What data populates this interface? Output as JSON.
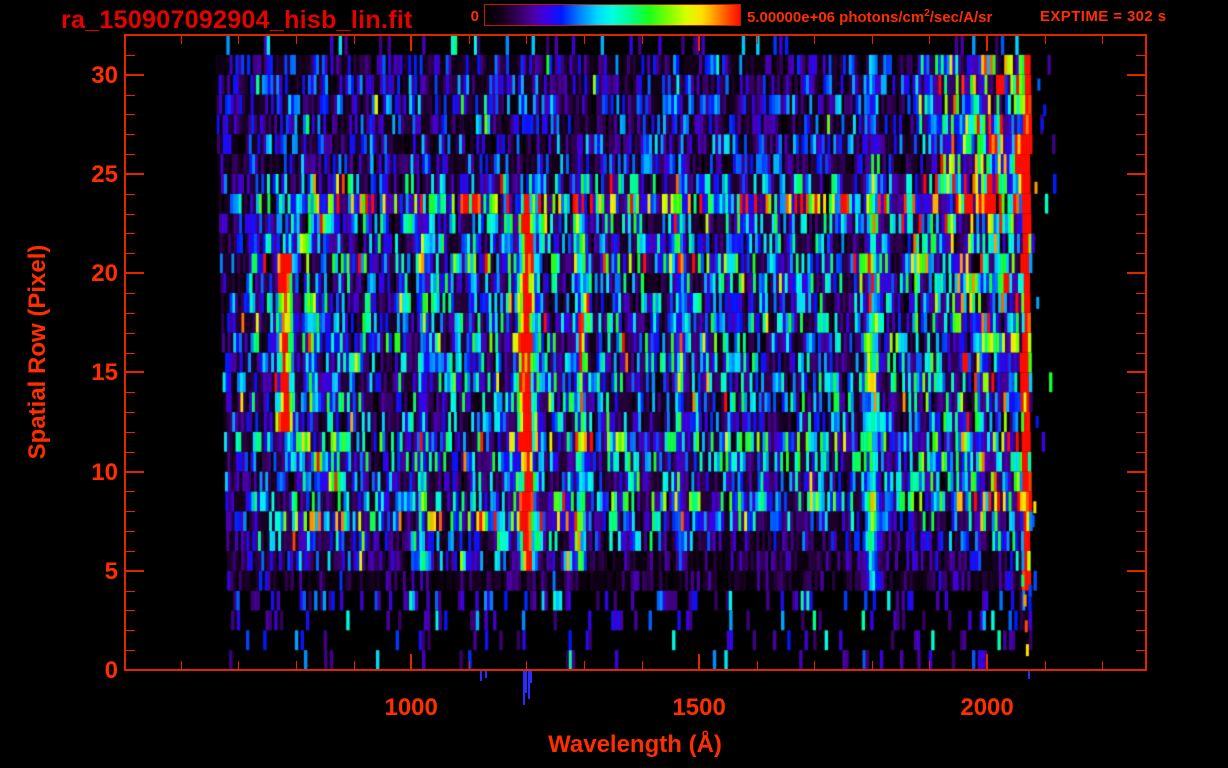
{
  "window": {
    "background": "#000000"
  },
  "colors": {
    "accent": "#e02600",
    "label": "#ff2e00",
    "title": "#e60000",
    "stray_mark": "#2a2cff"
  },
  "header": {
    "title": "ra_150907092904_hisb_lin.fit",
    "colorbar_min_label": "0",
    "colorbar_max_prefix": "5.00000e+06 photons/cm",
    "colorbar_max_sup": "2",
    "colorbar_max_suffix": "/sec/A/sr",
    "exptime_label": "EXPTIME = 302 s"
  },
  "axes": {
    "x_label": "Wavelength (Å)",
    "y_label": "Spatial Row (Pixel)",
    "x_tick_labels": [
      "1000",
      "1500",
      "2000"
    ],
    "y_tick_labels": [
      "0",
      "5",
      "10",
      "15",
      "20",
      "25",
      "30"
    ]
  },
  "chart_data": {
    "type": "heatmap",
    "title": "ra_150907092904_hisb_lin.fit",
    "xlabel": "Wavelength (Å)",
    "ylabel": "Spatial Row (Pixel)",
    "xlim": [
      503,
      2276
    ],
    "ylim": [
      0,
      32
    ],
    "x_ticks_major": [
      1000,
      1500,
      2000
    ],
    "x_minor_range": [
      600,
      2200
    ],
    "x_tick_minor_step": 100,
    "y_ticks_major": [
      0,
      5,
      10,
      15,
      20,
      25,
      30
    ],
    "y_tick_minor_step": 1,
    "exptime_seconds": 302,
    "colorbar": {
      "min": 0,
      "max": 5000000,
      "min_label": "0",
      "max_label": "5.00000e+06 photons/cm2/sec/A/sr",
      "stops": [
        [
          0.0,
          "#000000"
        ],
        [
          0.07,
          "#16001e"
        ],
        [
          0.13,
          "#33005a"
        ],
        [
          0.19,
          "#4b00a8"
        ],
        [
          0.24,
          "#3c00e8"
        ],
        [
          0.3,
          "#0018ff"
        ],
        [
          0.37,
          "#0080ff"
        ],
        [
          0.44,
          "#00d8ff"
        ],
        [
          0.5,
          "#00ffe0"
        ],
        [
          0.57,
          "#00ff8c"
        ],
        [
          0.64,
          "#16ff1e"
        ],
        [
          0.72,
          "#7cff00"
        ],
        [
          0.79,
          "#d8ff00"
        ],
        [
          0.85,
          "#ffe000"
        ],
        [
          0.9,
          "#ff9c00"
        ],
        [
          0.95,
          "#ff4e00"
        ],
        [
          1.0,
          "#ff0c00"
        ]
      ]
    },
    "data_wavelength_range": [
      659,
      2076
    ],
    "left_edge_slope_A": 0.8,
    "column_width_A": 5,
    "row_intensity": [
      0.028,
      0.03,
      0.05,
      0.06,
      0.1,
      0.24,
      0.3,
      0.3,
      0.3,
      0.29,
      0.31,
      0.3,
      0.28,
      0.3,
      0.3,
      0.3,
      0.3,
      0.31,
      0.3,
      0.3,
      0.3,
      0.3,
      0.32,
      0.33,
      0.26,
      0.21,
      0.22,
      0.2,
      0.22,
      0.2,
      0.19,
      0.035
    ],
    "row_boosts": [
      {
        "row": 23,
        "factor": 1.7,
        "wrange": [
          810,
          2055
        ]
      },
      {
        "row": 24,
        "factor": 1.2,
        "wrange": [
          810,
          2055
        ]
      },
      {
        "row": 7,
        "factor": 1.55,
        "wrange": [
          770,
          1290
        ]
      },
      {
        "row": 11,
        "factor": 1.3,
        "wrange": [
          820,
          1900
        ]
      },
      {
        "row": 16,
        "factor": 1.25,
        "wrange": [
          820,
          1900
        ]
      },
      {
        "row": 20,
        "factor": 1.25,
        "wrange": [
          820,
          1900
        ]
      },
      {
        "row": 8,
        "factor": 1.2,
        "wrange": [
          1180,
          1900
        ]
      },
      {
        "row": 5,
        "factor": 0.45,
        "wrange": [
          1300,
          2080
        ]
      },
      {
        "row": 6,
        "factor": 0.6,
        "wrange": [
          1420,
          2080
        ]
      }
    ],
    "emission_lines": [
      {
        "wavelength": 1020,
        "amplitude": 0.26,
        "sigma": 5,
        "rows": [
          5,
          23.5
        ]
      },
      {
        "wavelength": 1201,
        "amplitude": 1.0,
        "sigma": 6,
        "rows": [
          4.6,
          23.6
        ]
      },
      {
        "wavelength": 1201,
        "amplitude": 0.2,
        "sigma": 16,
        "rows": [
          4.6,
          23.2
        ]
      },
      {
        "wavelength": 1295,
        "amplitude": 0.38,
        "sigma": 6,
        "rows": [
          5,
          24
        ]
      },
      {
        "wavelength": 1467,
        "amplitude": 0.2,
        "sigma": 6,
        "rows": [
          5,
          24
        ]
      },
      {
        "wavelength": 1802,
        "amplitude": 0.42,
        "sigma": 7,
        "rows": [
          4,
          25
        ]
      },
      {
        "wavelength": 1802,
        "amplitude": 0.17,
        "sigma": 7,
        "rows": [
          25,
          31
        ]
      },
      {
        "wavelength": 2068,
        "amplitude": 1.1,
        "sigma": 4,
        "rows": [
          2.5,
          31
        ]
      }
    ],
    "arc": {
      "core": {
        "wavelength": 781,
        "amplitude": 0.9,
        "sigma": 7,
        "rows": [
          12.5,
          20.5
        ]
      },
      "top_hook": {
        "rows": [
          20.5,
          23.2
        ],
        "w_start": 781,
        "w_end": 872,
        "amplitude": 0.6,
        "sigma": 9
      },
      "bottom_hook": {
        "rows": [
          9.4,
          12.5
        ],
        "w_start": 781,
        "w_end": 872,
        "amplitude": 0.6,
        "sigma": 9
      },
      "inner": {
        "wavelength": 830,
        "amplitude": 0.26,
        "sigma": 7,
        "rows": [
          13.5,
          19.2
        ]
      }
    },
    "continuum": {
      "rise_wrange": [
        1850,
        2060
      ],
      "rise_max_factor": 1.9,
      "upper_rows_extra": 1.6,
      "upper_rows_min": 24,
      "left_dim_below": 720,
      "left_dim_factor": 0.8
    },
    "noise": {
      "seed": 7,
      "gap_probability": 0.1,
      "gap_factor": 0.12,
      "fleck_probability": 0.05,
      "fleck_factor": 1.8
    },
    "lyman_lower_specks": {
      "wrange": [
        1192,
        1212
      ],
      "max_row": 4.5,
      "probability": 0.3
    },
    "beyond_edge_specks": {
      "wmax": 2115,
      "probability": 0.035
    },
    "outlier_specks": [
      {
        "wavelength": 2085,
        "row": 24.3,
        "value": 0.9
      },
      {
        "wavelength": 2090,
        "row": 29.5,
        "value": 0.35
      },
      {
        "wavelength": 2088,
        "row": 18.5,
        "value": 0.4
      },
      {
        "wavelength": 2096,
        "row": 27.5,
        "value": 0.3
      },
      {
        "wavelength": 2083,
        "row": 8.2,
        "value": 0.85
      },
      {
        "wavelength": 2087,
        "row": 12.5,
        "value": 0.3
      },
      {
        "wavelength": 2100,
        "row": 28.2,
        "value": 0.3
      },
      {
        "wavelength": 2062,
        "row": 4.5,
        "value": 0.6
      },
      {
        "wavelength": 2066,
        "row": 3.5,
        "value": 0.9
      },
      {
        "wavelength": 2068,
        "row": 2.2,
        "value": 0.95
      },
      {
        "wavelength": 2070,
        "row": 1.0,
        "value": 0.85
      },
      {
        "wavelength": 2075,
        "row": 4.0,
        "value": 0.33
      },
      {
        "wavelength": 2080,
        "row": 7.5,
        "value": 0.35
      }
    ],
    "under_axis_marks": [
      {
        "wavelength": 1196,
        "length": 34
      },
      {
        "wavelength": 1200,
        "length": 22
      },
      {
        "wavelength": 1204,
        "length": 28
      },
      {
        "wavelength": 1208,
        "length": 12
      },
      {
        "wavelength": 1122,
        "length": 10
      },
      {
        "wavelength": 1130,
        "length": 7
      },
      {
        "wavelength": 2072,
        "length": 8
      }
    ]
  }
}
